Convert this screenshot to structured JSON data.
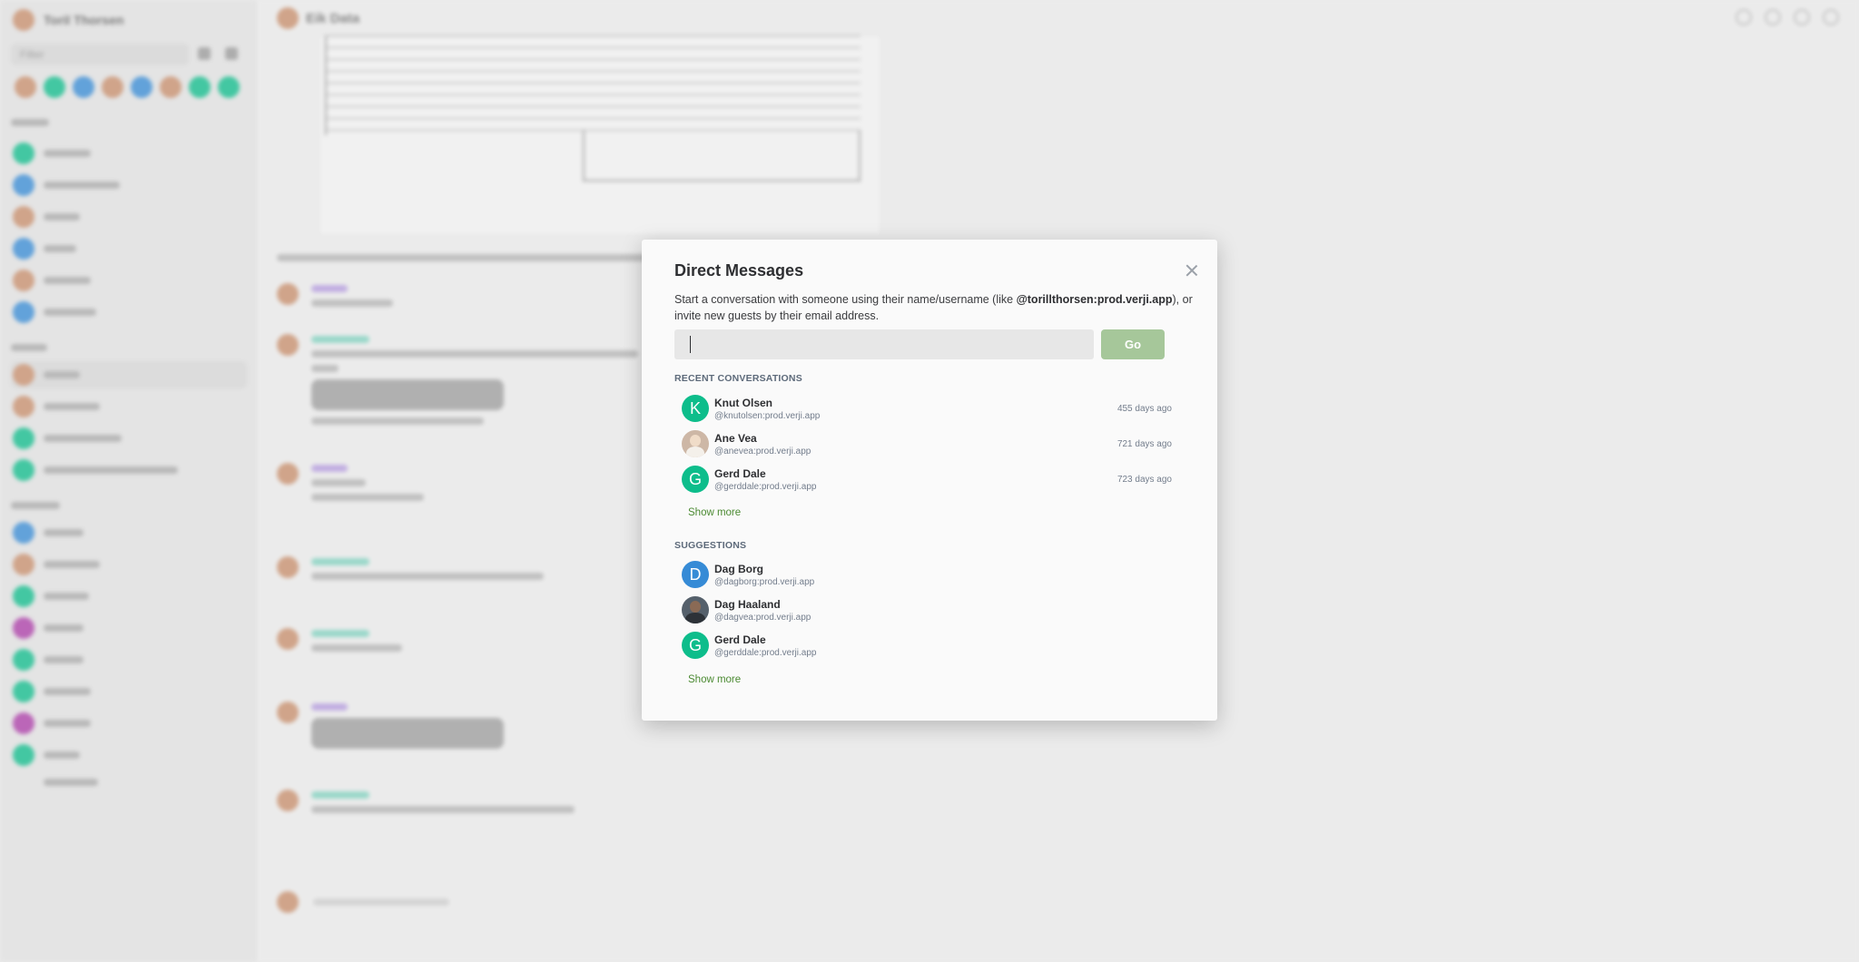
{
  "background": {
    "user_name": "Toril Thorsen",
    "filter_placeholder": "Filter",
    "room_name": "Eik Data"
  },
  "dialog": {
    "title": "Direct Messages",
    "description_before": "Start a conversation with someone using their name/username (like ",
    "description_example": "@torillthorsen:prod.verji.app",
    "description_after": "), or invite new guests by their email address.",
    "input_value": "",
    "go_label": "Go",
    "recent_heading": "RECENT CONVERSATIONS",
    "recent": [
      {
        "initial": "K",
        "name": "Knut Olsen",
        "user_id": "@knutolsen:prod.verji.app",
        "time": "455 days ago"
      },
      {
        "initial": "",
        "name": "Ane Vea",
        "user_id": "@anevea:prod.verji.app",
        "time": "721 days ago"
      },
      {
        "initial": "G",
        "name": "Gerd Dale",
        "user_id": "@gerddale:prod.verji.app",
        "time": "723 days ago"
      }
    ],
    "recent_show_more": "Show more",
    "suggestions_heading": "SUGGESTIONS",
    "suggestions": [
      {
        "initial": "D",
        "name": "Dag Borg",
        "user_id": "@dagborg:prod.verji.app"
      },
      {
        "initial": "",
        "name": "Dag Haaland",
        "user_id": "@dagvea:prod.verji.app"
      },
      {
        "initial": "G",
        "name": "Gerd Dale",
        "user_id": "@gerddale:prod.verji.app"
      }
    ],
    "suggestions_show_more": "Show more"
  },
  "colors": {
    "avatar_green": "#0dbd8b",
    "avatar_blue": "#368bd6",
    "go_button": "#a6c79a",
    "link_green": "#4b8a32"
  },
  "icons": {
    "close": "close-icon"
  }
}
